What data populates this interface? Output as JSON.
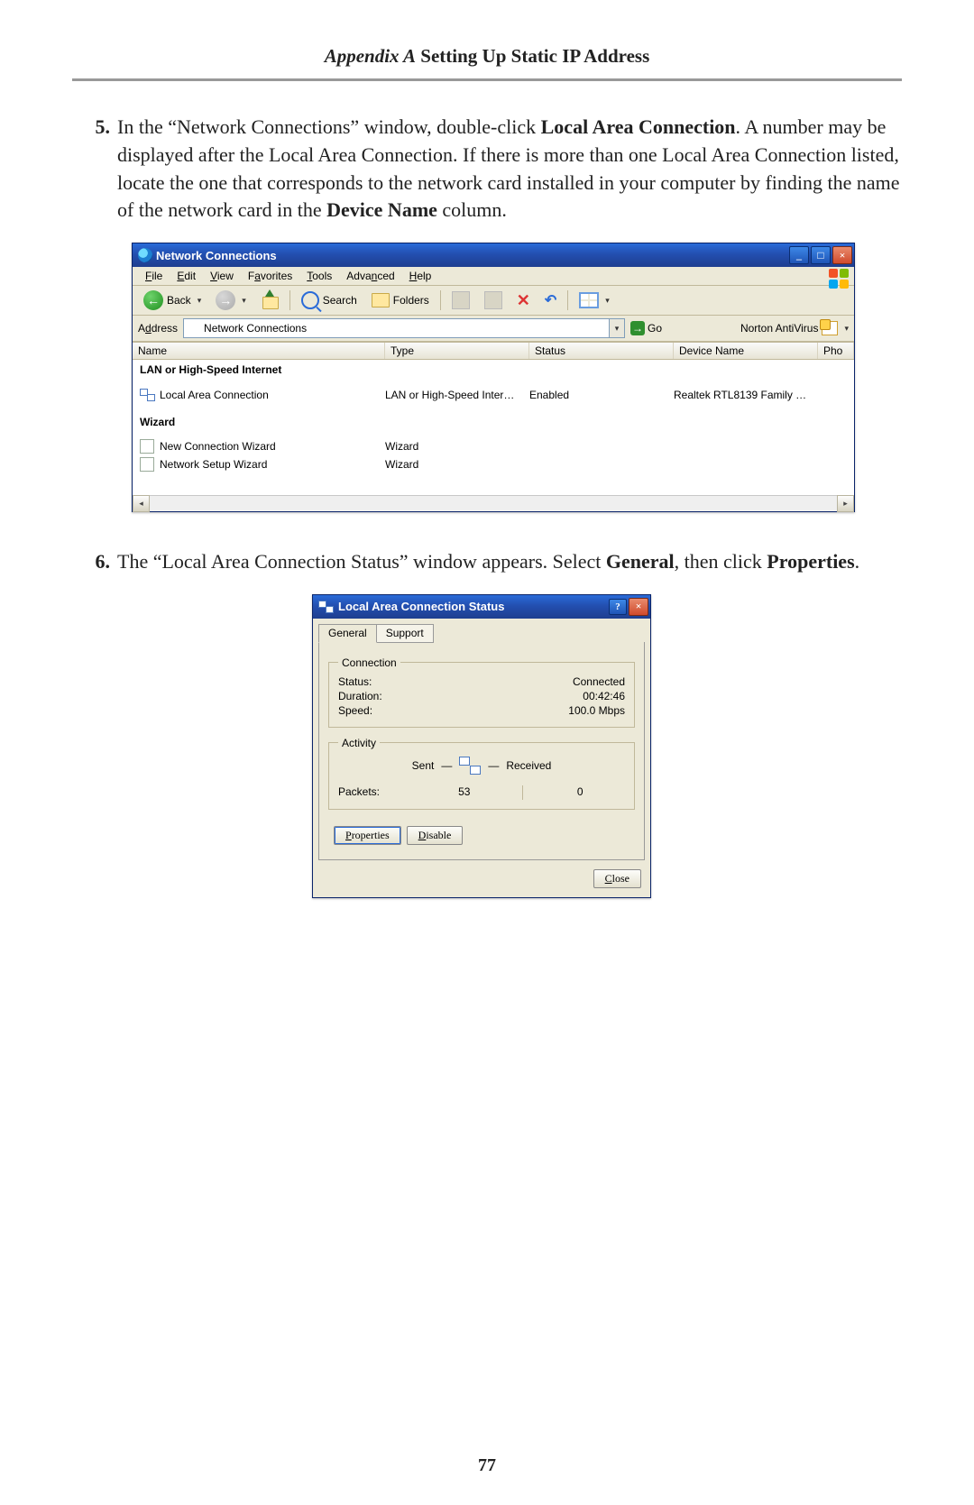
{
  "header": {
    "appendix": "Appendix A",
    "title_rest": "  Setting Up Static IP Address"
  },
  "step5": {
    "num": "5.",
    "t1": "In the “Network Connections” window, double-click ",
    "b1": "Local Area Connection",
    "t2": ". A number may be displayed after the Local Area Connection. If there is more than one Local Area Connection listed, locate the one that corresponds to the network card installed in your computer by finding the name of the network card in the ",
    "b2": "Device Name",
    "t3": " column."
  },
  "step6": {
    "num": "6.",
    "t1": "The “Local Area Connection Status” window appears. Select ",
    "b1": "General",
    "t2": ", then click ",
    "b2": "Properties",
    "t3": "."
  },
  "page_number": "77",
  "xp1": {
    "title": "Network Connections",
    "menu": {
      "file": "File",
      "edit": "Edit",
      "view": "View",
      "favorites": "Favorites",
      "tools": "Tools",
      "advanced": "Advanced",
      "help": "Help"
    },
    "toolbar": {
      "back": "Back",
      "search": "Search",
      "folders": "Folders"
    },
    "address_label": "Address",
    "address_value": "Network Connections",
    "go": "Go",
    "norton": "Norton AntiVirus",
    "columns": {
      "name": "Name",
      "type": "Type",
      "status": "Status",
      "device": "Device Name",
      "pho": "Pho"
    },
    "group_lan": "LAN or High-Speed Internet",
    "row_lan": {
      "name": "Local Area Connection",
      "type": "LAN or High-Speed Inter…",
      "status": "Enabled",
      "device": "Realtek RTL8139 Family …"
    },
    "group_wizard": "Wizard",
    "row_wiz1": {
      "name": "New Connection Wizard",
      "type": "Wizard"
    },
    "row_wiz2": {
      "name": "Network Setup Wizard",
      "type": "Wizard"
    }
  },
  "xp2": {
    "title": "Local Area Connection Status",
    "tabs": {
      "general": "General",
      "support": "Support"
    },
    "connection": {
      "legend": "Connection",
      "status_lbl": "Status:",
      "status_val": "Connected",
      "duration_lbl": "Duration:",
      "duration_val": "00:42:46",
      "speed_lbl": "Speed:",
      "speed_val": "100.0 Mbps"
    },
    "activity": {
      "legend": "Activity",
      "sent": "Sent",
      "received": "Received",
      "packets_lbl": "Packets:",
      "sent_val": "53",
      "recv_val": "0"
    },
    "buttons": {
      "properties": "Properties",
      "disable": "Disable",
      "close": "Close"
    }
  }
}
